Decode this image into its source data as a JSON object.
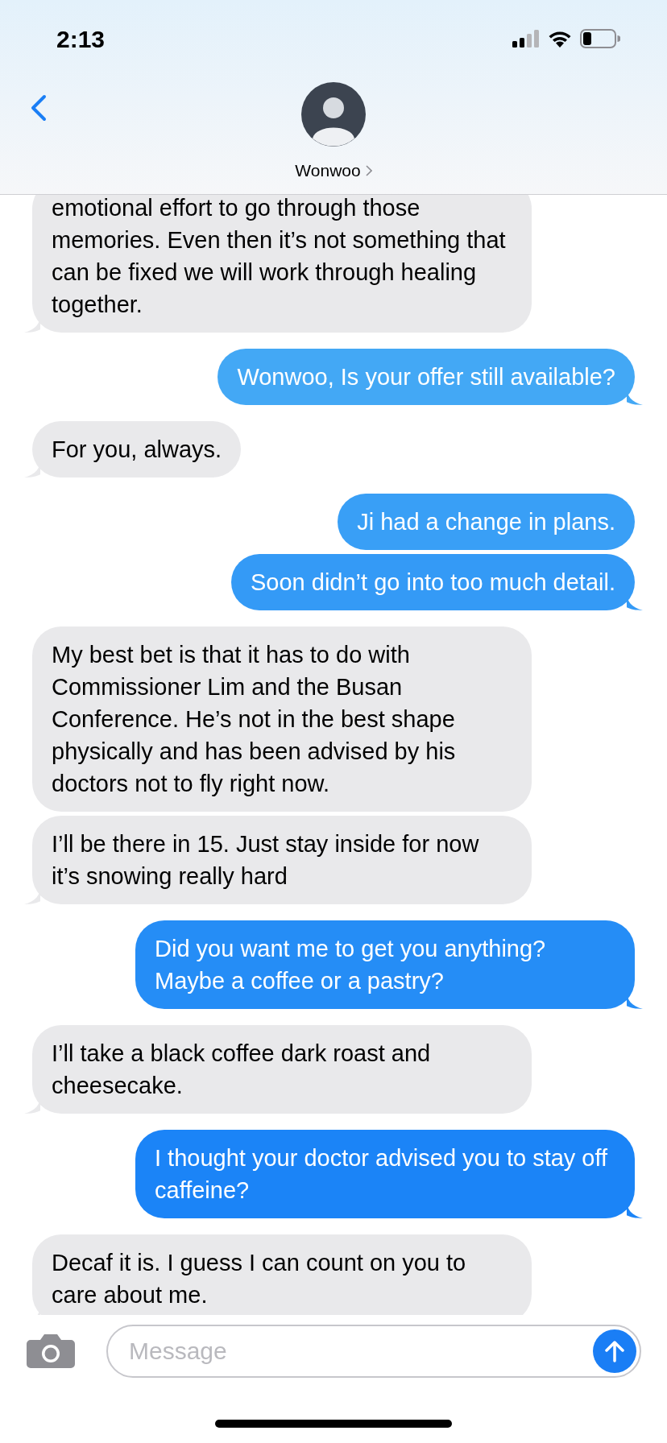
{
  "status_bar": {
    "time": "2:13"
  },
  "contact": {
    "name": "Wonwoo"
  },
  "messages": [
    {
      "kind": "incoming",
      "text": "emotional effort to go through those memories. Even then it’s not something that can be fixed we will work through healing together."
    },
    {
      "kind": "outgoing",
      "text": "Wonwoo, Is your offer still available?"
    },
    {
      "kind": "incoming",
      "text": "For you, always."
    },
    {
      "kind": "outgoing",
      "text": "Ji had a change in plans."
    },
    {
      "kind": "outgoing",
      "text": "Soon didn’t go into too much detail."
    },
    {
      "kind": "incoming",
      "text": "My best bet is that it has to do with Commissioner Lim and the Busan Conference.  He’s not in the best shape physically and has been advised by his doctors not to fly right now."
    },
    {
      "kind": "incoming",
      "text": "I’ll be there in 15. Just stay inside for now it’s snowing really hard"
    },
    {
      "kind": "outgoing",
      "text": "Did you want me to get you anything? Maybe a coffee or a pastry?"
    },
    {
      "kind": "incoming",
      "text": "I’ll take a black coffee dark roast and cheesecake."
    },
    {
      "kind": "outgoing",
      "text": "I thought your doctor advised you to stay off caffeine?"
    },
    {
      "kind": "incoming",
      "text": "Decaf it is. I guess I can count on you to care about me."
    }
  ],
  "composer": {
    "placeholder": "Message"
  }
}
